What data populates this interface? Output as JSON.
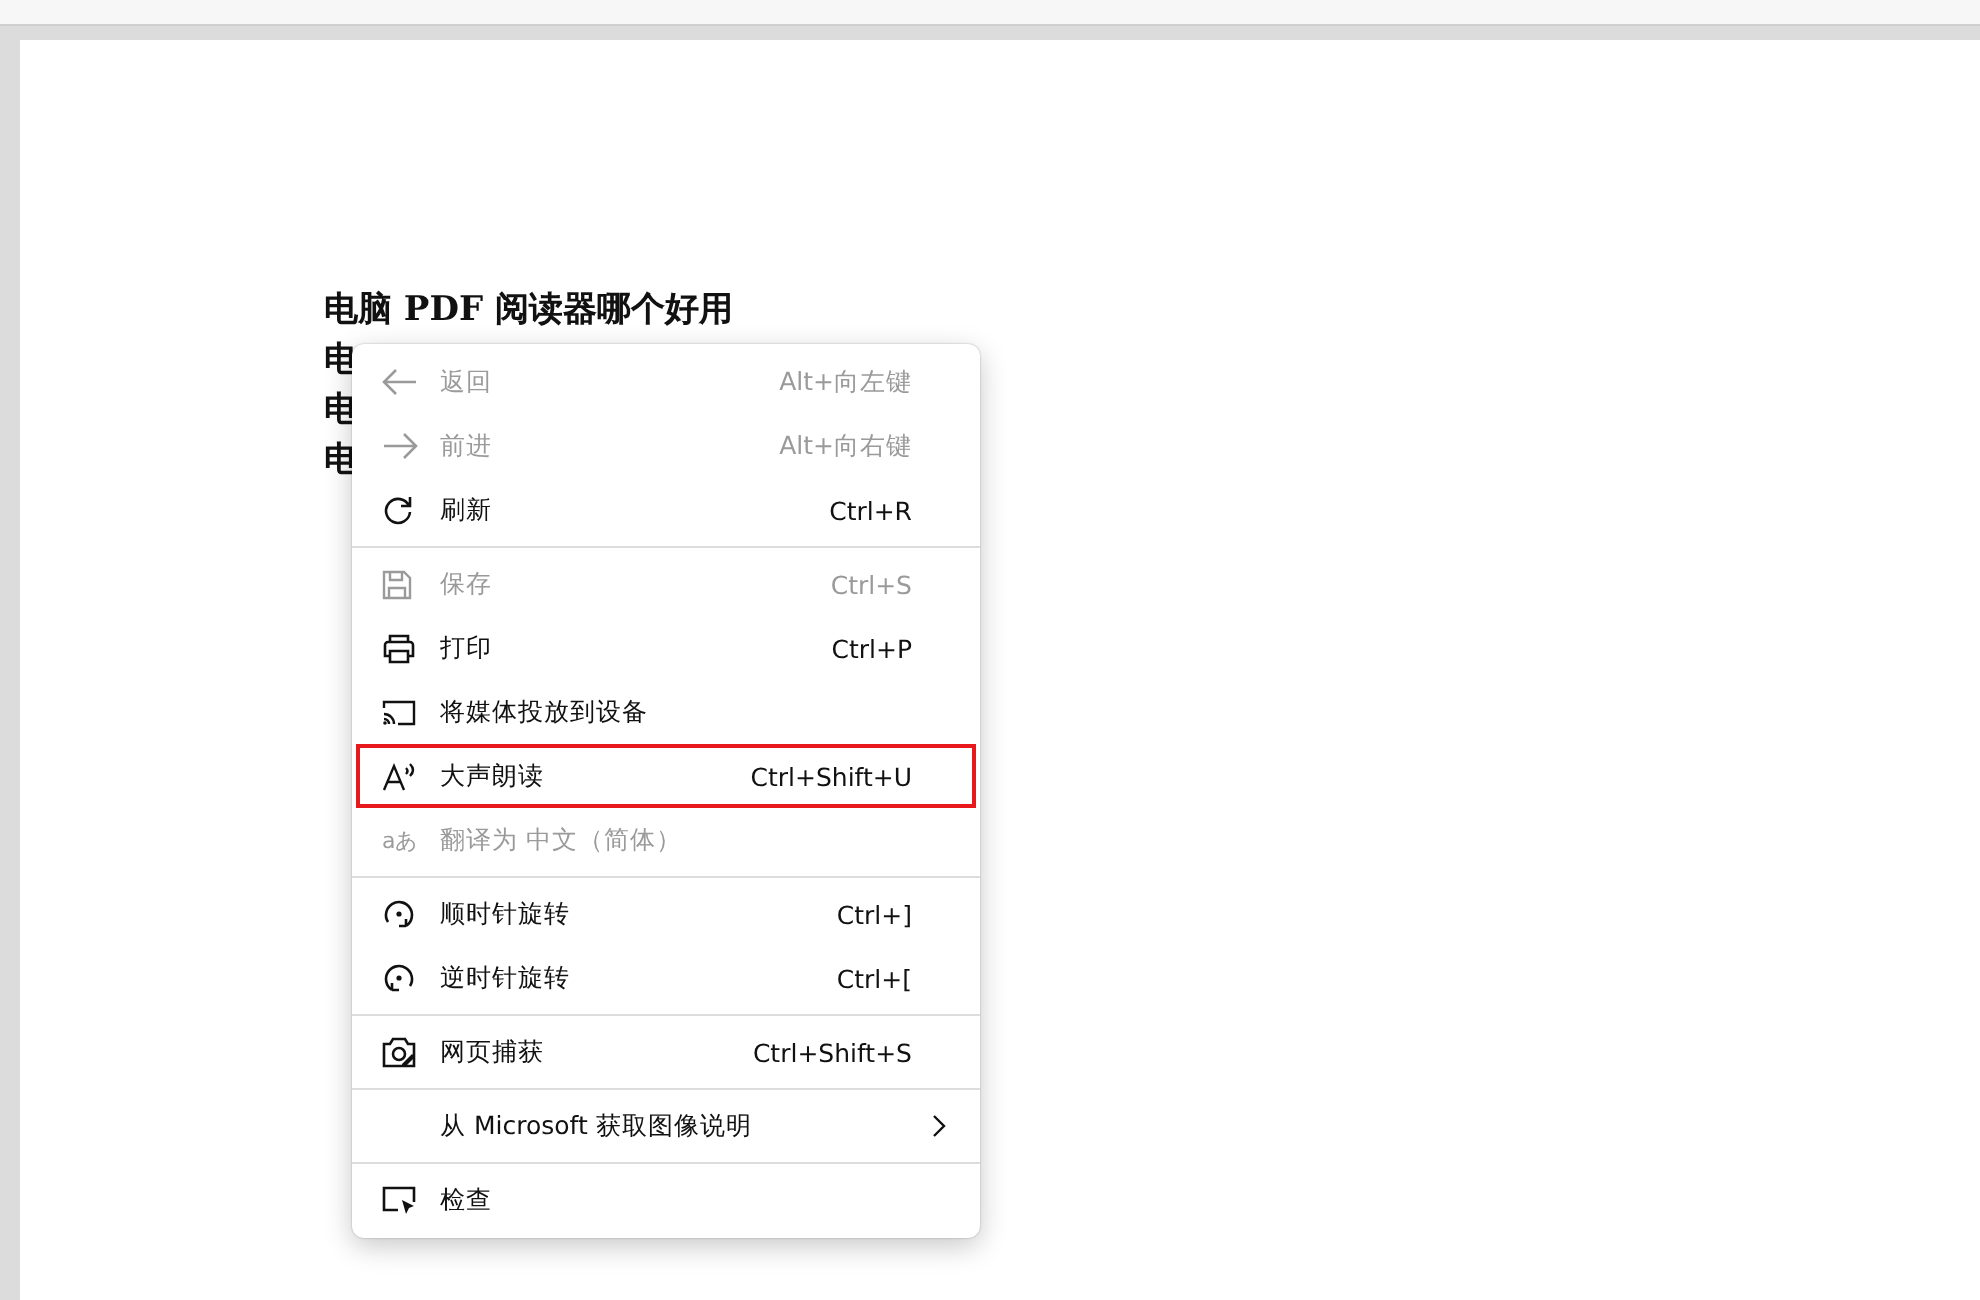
{
  "document": {
    "lines": [
      "电脑 PDF 阅读器哪个好用",
      "电",
      "电",
      "电"
    ]
  },
  "context_menu": {
    "groups": [
      {
        "items": [
          {
            "label": "返回",
            "shortcut": "Alt+向左键",
            "disabled": true,
            "highlighted": false
          },
          {
            "label": "前进",
            "shortcut": "Alt+向右键",
            "disabled": true,
            "highlighted": false
          },
          {
            "label": "刷新",
            "shortcut": "Ctrl+R",
            "disabled": false,
            "highlighted": false
          }
        ]
      },
      {
        "items": [
          {
            "label": "保存",
            "shortcut": "Ctrl+S",
            "disabled": true,
            "highlighted": false
          },
          {
            "label": "打印",
            "shortcut": "Ctrl+P",
            "disabled": false,
            "highlighted": false
          },
          {
            "label": "将媒体投放到设备",
            "disabled": false,
            "highlighted": false
          },
          {
            "label": "大声朗读",
            "shortcut": "Ctrl+Shift+U",
            "disabled": false,
            "highlighted": true
          },
          {
            "icon_text": "aあ",
            "label": "翻译为 中文（简体）",
            "disabled": true,
            "highlighted": false
          }
        ]
      },
      {
        "items": [
          {
            "label": "顺时针旋转",
            "shortcut": "Ctrl+]",
            "disabled": false,
            "highlighted": false
          },
          {
            "label": "逆时针旋转",
            "shortcut": "Ctrl+[",
            "disabled": false,
            "highlighted": false
          }
        ]
      },
      {
        "items": [
          {
            "label": "网页捕获",
            "shortcut": "Ctrl+Shift+S",
            "disabled": false,
            "highlighted": false
          }
        ]
      },
      {
        "items": [
          {
            "label": "从 Microsoft 获取图像说明",
            "submenu": true,
            "disabled": false,
            "highlighted": false
          }
        ]
      },
      {
        "items": [
          {
            "label": "检查",
            "disabled": false,
            "highlighted": false
          }
        ]
      }
    ]
  }
}
